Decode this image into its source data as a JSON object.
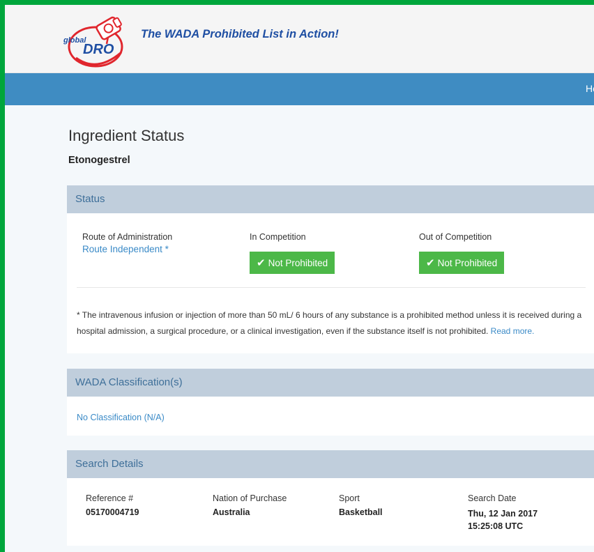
{
  "header": {
    "logo_text_top": "global",
    "logo_text_main": "DRO",
    "tagline": "The WADA Prohibited List in Action!"
  },
  "nav": {
    "home_label": "Ho"
  },
  "page": {
    "title": "Ingredient Status",
    "ingredient": "Etonogestrel"
  },
  "status": {
    "heading": "Status",
    "route_label": "Route of Administration",
    "route_value": "Route Independent  *",
    "in_comp_label": "In Competition",
    "in_comp_status": "Not Prohibited",
    "out_comp_label": "Out of Competition",
    "out_comp_status": "Not Prohibited",
    "footnote_text": "* The intravenous infusion or injection of more than 50 mL/ 6 hours of any substance is a prohibited method unless it is received during a hospital admission, a surgical procedure, or a clinical investigation, even if the substance itself is not prohibited.",
    "read_more": "Read more."
  },
  "classification": {
    "heading": "WADA Classification(s)",
    "value": "No Classification (N/A)"
  },
  "search_details": {
    "heading": "Search Details",
    "reference_label": "Reference #",
    "reference_value": "05170004719",
    "nation_label": "Nation of Purchase",
    "nation_value": "Australia",
    "sport_label": "Sport",
    "sport_value": "Basketball",
    "date_label": "Search Date",
    "date_value": "Thu, 12 Jan 2017 15:25:08 UTC"
  },
  "icons": {
    "check": "check-icon",
    "logo": "globaldro-logo"
  },
  "colors": {
    "border_green": "#00a63c",
    "nav_blue": "#3f8cc2",
    "panel_heading": "#c0cedc",
    "badge_green": "#4cb848",
    "link_blue": "#3a8ac7",
    "tagline_blue": "#1f4fa3"
  }
}
